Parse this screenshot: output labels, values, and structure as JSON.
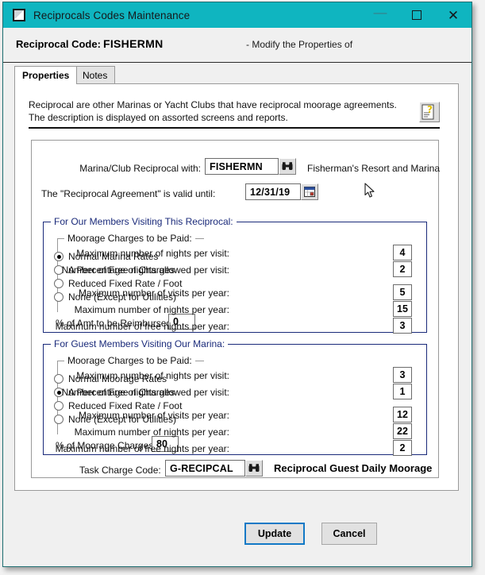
{
  "window": {
    "title": "Reciprocals Codes Maintenance",
    "icon": "window-restore-icon",
    "minimize": "—",
    "maximize": "",
    "close": "✕",
    "titlebar_color": "#0fb5c0"
  },
  "header": {
    "label": "Reciprocal Code:",
    "code": "FISHERMN",
    "mode": "- Modify the Properties of"
  },
  "tabs": [
    {
      "label": "Properties",
      "active": true
    },
    {
      "label": "Notes",
      "active": false
    }
  ],
  "description": "Reciprocal are other Marinas or Yacht Clubs that have reciprocal moorage agreements.\nThe description is displayed on assorted screens and reports.",
  "help_icon": "help-document-icon",
  "top_form": {
    "marina_label": "Marina/Club Reciprocal with:",
    "marina_value": "FISHERMN",
    "marina_lookup_icon": "binoculars-icon",
    "marina_description": "Fisherman's Resort and Marina",
    "valid_label": "The \"Reciprocal Agreement\" is valid until:",
    "valid_value": "12/31/19",
    "valid_picker_icon": "calendar-icon"
  },
  "members_section": {
    "legend": "For Our Members Visiting This Reciprocal:",
    "radio_group_legend": "Moorage Charges to be Paid:",
    "radios": [
      {
        "label": "Normal Marina Rates",
        "selected": true
      },
      {
        "label": "A Percentage of Charges",
        "selected": false
      },
      {
        "label": "Reduced Fixed Rate / Foot",
        "selected": false
      },
      {
        "label": "None (Except for Utilities)",
        "selected": false
      }
    ],
    "pct_label": "% of Amt to be Reimbursed:",
    "pct_value": "0",
    "fields": [
      {
        "label": "Maximum number of nights per visit:",
        "value": "4"
      },
      {
        "label": "Number of Free nights allowed per visit:",
        "value": "2"
      },
      {
        "label": "Maximum number of visits per year:",
        "value": "5"
      },
      {
        "label": "Maximum number of nights per year:",
        "value": "15"
      },
      {
        "label": "Maximum number of free nights per year:",
        "value": "3"
      }
    ]
  },
  "guests_section": {
    "legend": "For Guest Members Visiting Our Marina:",
    "radio_group_legend": "Moorage Charges to be Paid:",
    "radios": [
      {
        "label": "Normal Moorage Rates",
        "selected": false
      },
      {
        "label": "A Percentage of Charges",
        "selected": true
      },
      {
        "label": "Reduced Fixed Rate / Foot",
        "selected": false
      },
      {
        "label": "None (Except for Utilities)",
        "selected": false
      }
    ],
    "pct_label": "% of Moorage Charges:",
    "pct_value": "80",
    "fields": [
      {
        "label": "Maximum number of nights per visit:",
        "value": "3"
      },
      {
        "label": "Number of Free nights allowed per visit:",
        "value": "1"
      },
      {
        "label": "Maximum number of visits per year:",
        "value": "12"
      },
      {
        "label": "Maximum number of nights per year:",
        "value": "22"
      },
      {
        "label": "Maximum number of free nights per year:",
        "value": "2"
      }
    ],
    "task_label": "Task Charge Code:",
    "task_value": "G-RECIPCAL",
    "task_lookup_icon": "binoculars-icon",
    "task_description": "Reciprocal Guest Daily Moorage"
  },
  "buttons": {
    "update": "Update",
    "cancel": "Cancel",
    "focus_color": "#1279c6"
  }
}
